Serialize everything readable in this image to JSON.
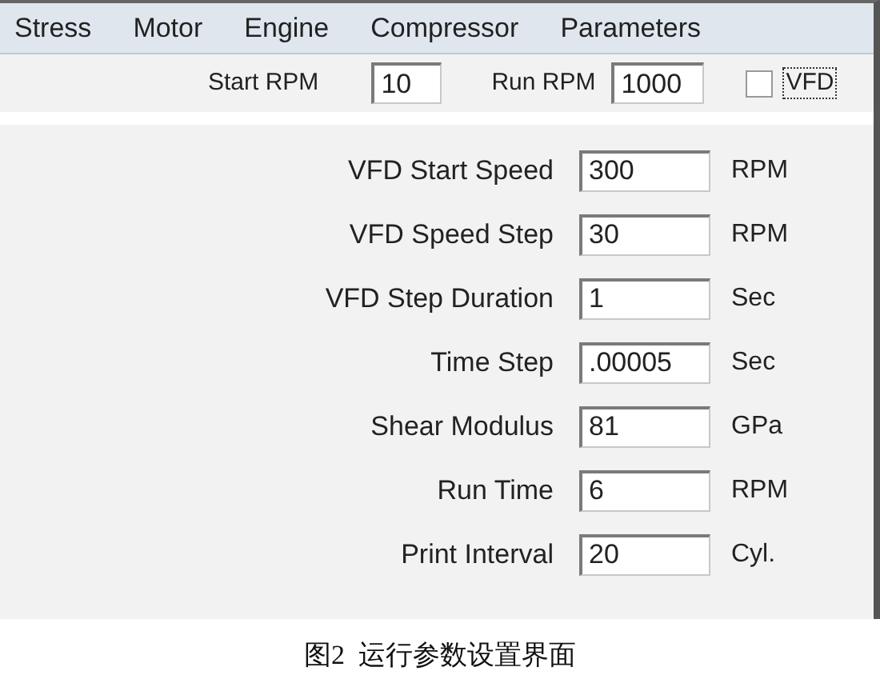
{
  "menu": [
    "Stress",
    "Motor",
    "Engine",
    "Compressor",
    "Parameters"
  ],
  "toolbar": {
    "start_rpm": {
      "label": "Start RPM",
      "value": "10"
    },
    "run_rpm": {
      "label": "Run RPM",
      "value": "1000"
    },
    "vfd": {
      "label": "VFD",
      "checked": false
    }
  },
  "parameters": [
    {
      "label": "VFD Start Speed",
      "value": "300",
      "unit": "RPM"
    },
    {
      "label": "VFD Speed Step",
      "value": "30",
      "unit": "RPM"
    },
    {
      "label": "VFD Step Duration",
      "value": "1",
      "unit": "Sec"
    },
    {
      "label": "Time Step",
      "value": ".00005",
      "unit": "Sec"
    },
    {
      "label": "Shear Modulus",
      "value": "81",
      "unit": "GPa"
    },
    {
      "label": "Run Time",
      "value": "6",
      "unit": "RPM"
    },
    {
      "label": "Print Interval",
      "value": "20",
      "unit": "Cyl."
    }
  ],
  "caption": "图2  运行参数设置界面"
}
